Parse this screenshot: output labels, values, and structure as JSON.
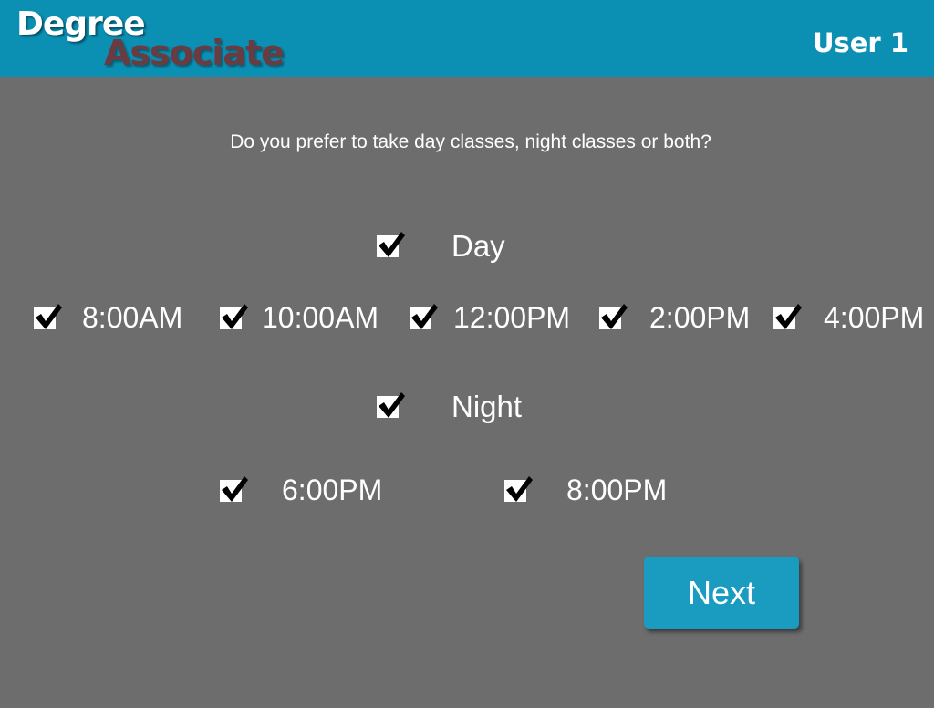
{
  "header": {
    "logo_line1": "Degree",
    "logo_line2": "Associate",
    "user_label": "User 1",
    "bar_color": "#0b8fb3",
    "logo_line2_color": "#6a3b40"
  },
  "question": "Do you prefer to take day classes, night classes or both?",
  "day": {
    "label": "Day",
    "checked": true,
    "times": [
      {
        "label": "8:00AM",
        "checked": true
      },
      {
        "label": "10:00AM",
        "checked": true
      },
      {
        "label": "12:00PM",
        "checked": true
      },
      {
        "label": "2:00PM",
        "checked": true
      },
      {
        "label": "4:00PM",
        "checked": true
      }
    ]
  },
  "night": {
    "label": "Night",
    "checked": true,
    "times": [
      {
        "label": "6:00PM",
        "checked": true
      },
      {
        "label": "8:00PM",
        "checked": true
      }
    ]
  },
  "next_button": {
    "label": "Next",
    "color": "#1a9cc0"
  },
  "background_color": "#6d6d6d"
}
